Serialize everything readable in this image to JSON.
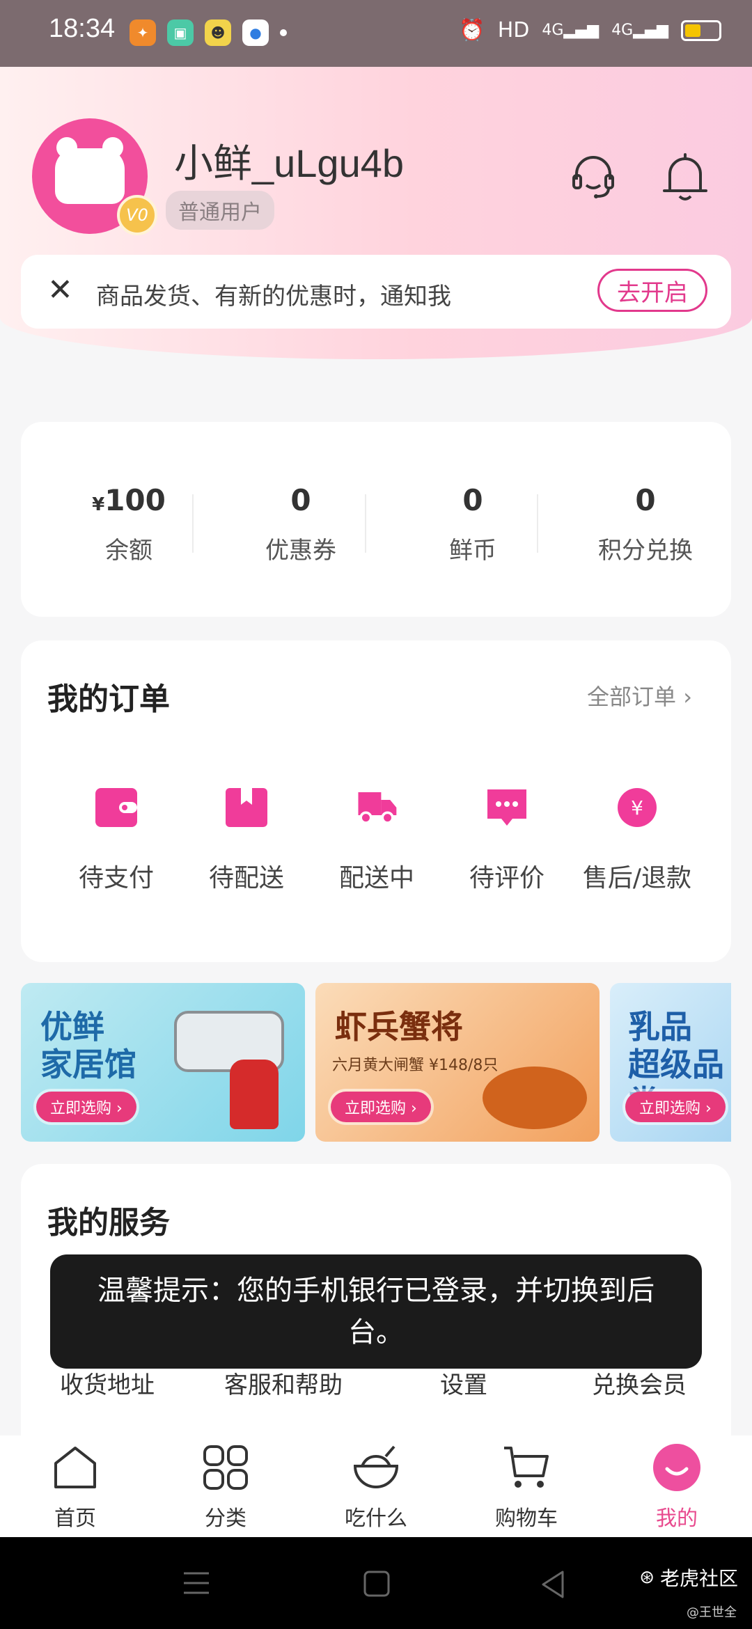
{
  "status_bar": {
    "time": "18:34",
    "network": "HD",
    "signal": "4G",
    "battery_level": 0.5
  },
  "profile": {
    "username": "小鲜_uLgu4b",
    "level": "普通用户",
    "vip_badge": "V0"
  },
  "notice": {
    "text": "商品发货、有新的优惠时，通知我",
    "button": "去开启"
  },
  "stats": [
    {
      "currency": "¥",
      "value": "100",
      "label": "余额"
    },
    {
      "currency": "",
      "value": "0",
      "label": "优惠券"
    },
    {
      "currency": "",
      "value": "0",
      "label": "鲜币"
    },
    {
      "currency": "",
      "value": "0",
      "label": "积分兑换"
    }
  ],
  "orders": {
    "title": "我的订单",
    "all_link": "全部订单 ›",
    "items": [
      "待支付",
      "待配送",
      "配送中",
      "待评价",
      "售后/退款"
    ]
  },
  "banners": [
    {
      "title": "优鲜\n家居馆",
      "subtitle": "",
      "button": "立即选购 ›"
    },
    {
      "title": "虾兵蟹将",
      "subtitle": "六月黄大闸蟹 ¥148/8只",
      "button": "立即选购 ›"
    },
    {
      "title": "乳品\n超级品类",
      "subtitle": "",
      "button": "立即选购 ›"
    }
  ],
  "services": {
    "title": "我的服务",
    "items": [
      "收货地址",
      "客服和帮助",
      "设置",
      "兑换会员"
    ]
  },
  "toast": "温馨提示：您的手机银行已登录，并切换到后台。",
  "tabbar": [
    "首页",
    "分类",
    "吃什么",
    "购物车",
    "我的"
  ],
  "watermark": {
    "name": "老虎社区",
    "author": "@王世全"
  },
  "colors": {
    "accent": "#e84a8e",
    "toast_bg": "#1b1b1b"
  }
}
